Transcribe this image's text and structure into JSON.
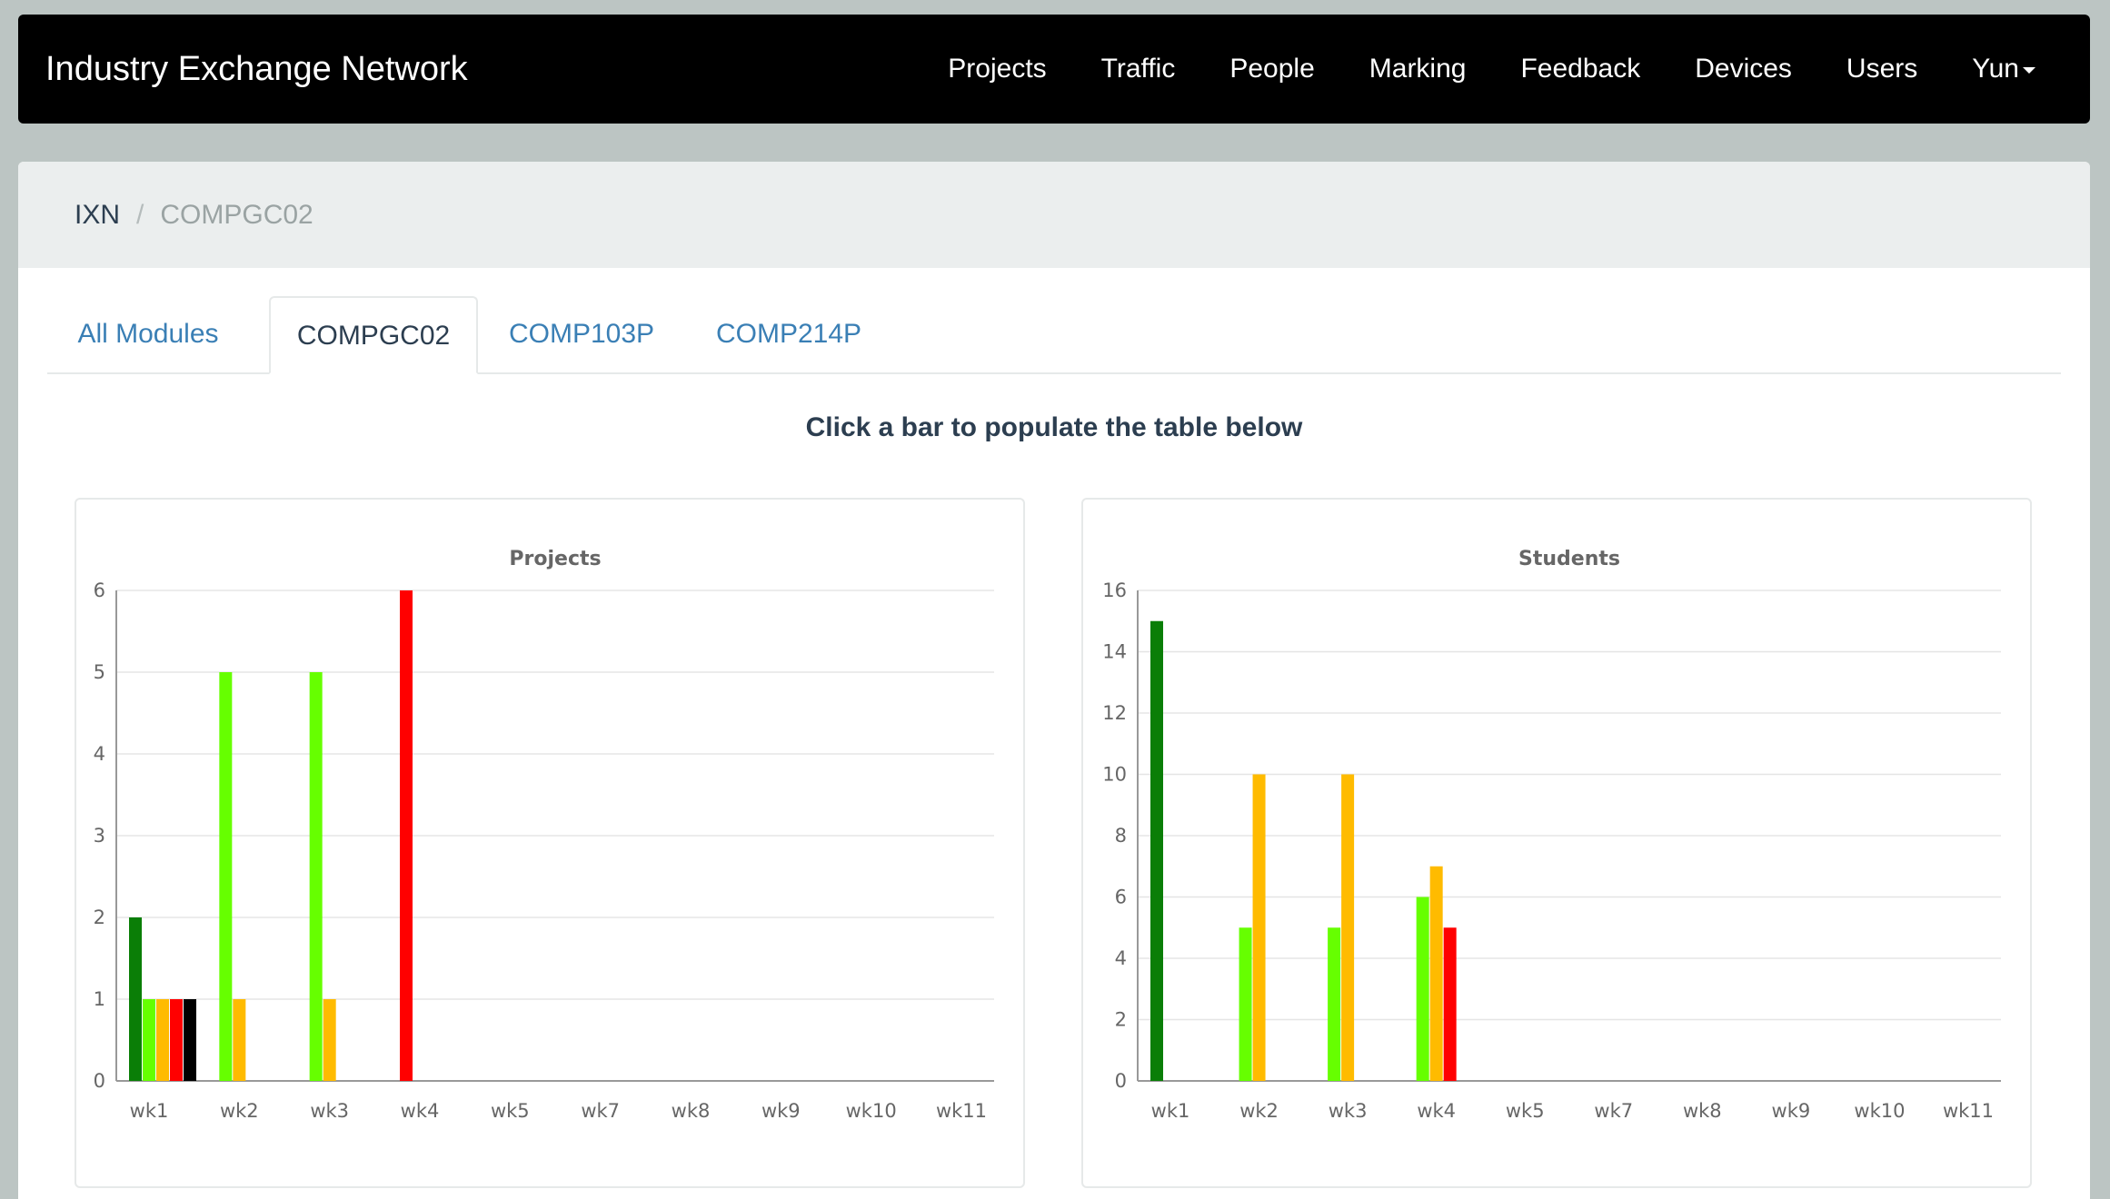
{
  "navbar": {
    "brand": "Industry Exchange Network",
    "links": [
      "Projects",
      "Traffic",
      "People",
      "Marking",
      "Feedback",
      "Devices",
      "Users"
    ],
    "user_menu": "Yun"
  },
  "breadcrumb": {
    "root": "IXN",
    "separator": "/",
    "current": "COMPGC02"
  },
  "tabs": [
    "All Modules",
    "COMPGC02",
    "COMP103P",
    "COMP214P"
  ],
  "active_tab": "COMPGC02",
  "instruction": "Click a bar to populate the table below",
  "colors": {
    "dark_green": "#0a7e07",
    "light_green": "#66ff00",
    "orange": "#ffbb00",
    "red": "#ff0000",
    "black": "#000000"
  },
  "chart_data": [
    {
      "type": "bar",
      "title": "Projects",
      "categories": [
        "wk1",
        "wk2",
        "wk3",
        "wk4",
        "wk5",
        "wk7",
        "wk8",
        "wk9",
        "wk10",
        "wk11"
      ],
      "ylim": [
        0,
        6
      ],
      "yticks": [
        0,
        1,
        2,
        3,
        4,
        5,
        6
      ],
      "grid": true,
      "series": [
        {
          "color": "#0a7e07",
          "values": [
            2,
            0,
            0,
            0,
            0,
            0,
            0,
            0,
            0,
            0
          ]
        },
        {
          "color": "#66ff00",
          "values": [
            1,
            5,
            5,
            0,
            0,
            0,
            0,
            0,
            0,
            0
          ]
        },
        {
          "color": "#ffbb00",
          "values": [
            1,
            1,
            1,
            0,
            0,
            0,
            0,
            0,
            0,
            0
          ]
        },
        {
          "color": "#ff0000",
          "values": [
            1,
            0,
            0,
            6,
            0,
            0,
            0,
            0,
            0,
            0
          ]
        },
        {
          "color": "#000000",
          "values": [
            1,
            0,
            0,
            0,
            0,
            0,
            0,
            0,
            0,
            0
          ]
        }
      ]
    },
    {
      "type": "bar",
      "title": "Students",
      "categories": [
        "wk1",
        "wk2",
        "wk3",
        "wk4",
        "wk5",
        "wk7",
        "wk8",
        "wk9",
        "wk10",
        "wk11"
      ],
      "ylim": [
        0,
        16
      ],
      "yticks": [
        0,
        2,
        4,
        6,
        8,
        10,
        12,
        14,
        16
      ],
      "grid": true,
      "series": [
        {
          "color": "#0a7e07",
          "values": [
            15,
            0,
            0,
            0,
            0,
            0,
            0,
            0,
            0,
            0
          ]
        },
        {
          "color": "#66ff00",
          "values": [
            0,
            5,
            5,
            6,
            0,
            0,
            0,
            0,
            0,
            0
          ]
        },
        {
          "color": "#ffbb00",
          "values": [
            0,
            10,
            10,
            7,
            0,
            0,
            0,
            0,
            0,
            0
          ]
        },
        {
          "color": "#ff0000",
          "values": [
            0,
            0,
            0,
            5,
            0,
            0,
            0,
            0,
            0,
            0
          ]
        },
        {
          "color": "#000000",
          "values": [
            0,
            0,
            0,
            0,
            0,
            0,
            0,
            0,
            0,
            0
          ]
        }
      ]
    }
  ]
}
